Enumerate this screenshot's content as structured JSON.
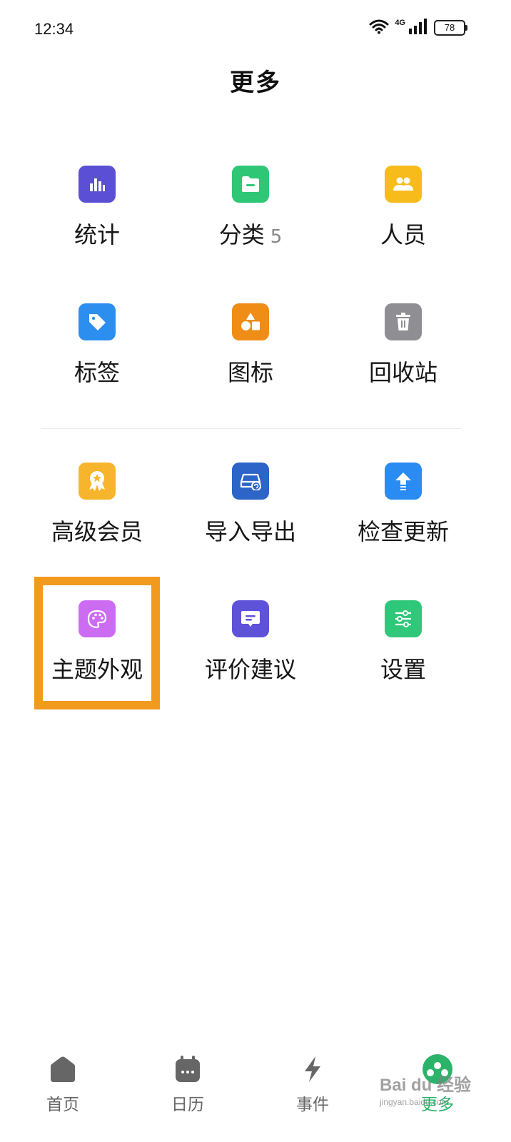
{
  "status_bar": {
    "time": "12:34",
    "network": "4G",
    "battery": "78",
    "icons": [
      "wifi-icon",
      "signal-icon",
      "battery-icon"
    ]
  },
  "title": "更多",
  "grid": [
    {
      "label": "统计",
      "icon": "bar-chart-icon",
      "color": "#5b4fd6"
    },
    {
      "label": "分类",
      "badge": "5",
      "icon": "folder-icon",
      "color": "#2fc776"
    },
    {
      "label": "人员",
      "icon": "people-icon",
      "color": "#f8bb1c"
    },
    {
      "label": "标签",
      "icon": "tag-icon",
      "color": "#2c8ff0"
    },
    {
      "label": "图标",
      "icon": "shapes-icon",
      "color": "#ef8d16"
    },
    {
      "label": "回收站",
      "icon": "trash-icon",
      "color": "#8e8e93"
    },
    {
      "label": "高级会员",
      "icon": "badge-icon",
      "color": "#f7b52d"
    },
    {
      "label": "导入导出",
      "icon": "drive-sync-icon",
      "color": "#2c64c8"
    },
    {
      "label": "检查更新",
      "icon": "upload-icon",
      "color": "#2a8cf2"
    },
    {
      "label": "主题外观",
      "icon": "palette-icon",
      "color": "#cc6cf3"
    },
    {
      "label": "评价建议",
      "icon": "message-icon",
      "color": "#5e52d8"
    },
    {
      "label": "设置",
      "icon": "sliders-icon",
      "color": "#2fc779"
    }
  ],
  "highlighted_item": "主题外观",
  "highlight_color": "#f29a1d",
  "bottom_nav": [
    {
      "label": "首页",
      "icon": "home-icon"
    },
    {
      "label": "日历",
      "icon": "calendar-icon"
    },
    {
      "label": "事件",
      "icon": "lightning-icon"
    },
    {
      "label": "更多",
      "icon": "more-icon",
      "active": true
    }
  ],
  "accent_color": "#2bb36a",
  "watermark": {
    "text": "Bai du 经验",
    "sub": "jingyan.baidu.com"
  }
}
